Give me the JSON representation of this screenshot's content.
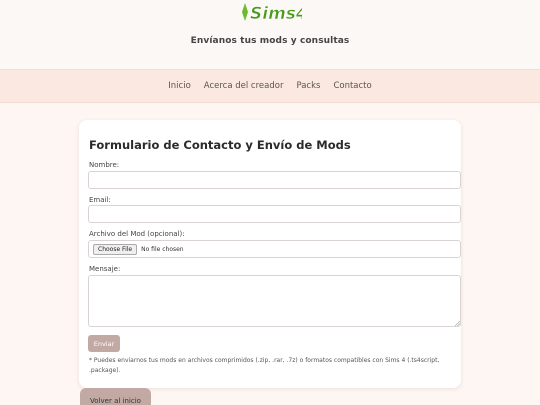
{
  "header": {
    "logo_text": "Sims4",
    "tagline": "Envíanos tus mods y consultas"
  },
  "nav": {
    "items": [
      "Inicio",
      "Acerca del creador",
      "Packs",
      "Contacto"
    ]
  },
  "form": {
    "title": "Formulario de Contacto y Envío de Mods",
    "name_label": "Nombre:",
    "name_value": "",
    "email_label": "Email:",
    "email_value": "",
    "file_label": "Archivo del Mod (opcional):",
    "file_button": "Choose File",
    "file_status": "No file chosen",
    "message_label": "Mensaje:",
    "message_value": "",
    "submit_label": "Enviar",
    "note": "* Puedes enviarnos tus mods en archivos comprimidos (.zip, .rar, .7z) o formatos compatibles con Sims 4 (.ts4script, .package)."
  },
  "footer": {
    "back_label": "Volver al inicio"
  },
  "colors": {
    "background": "#fdf6f3",
    "nav_background": "#fbe9e1",
    "button": "#c3a9a3",
    "logo_green": "#6dbb2c"
  },
  "icons": {
    "logo": "sims-plumbob-logo",
    "resize": "resize-grip-icon"
  }
}
